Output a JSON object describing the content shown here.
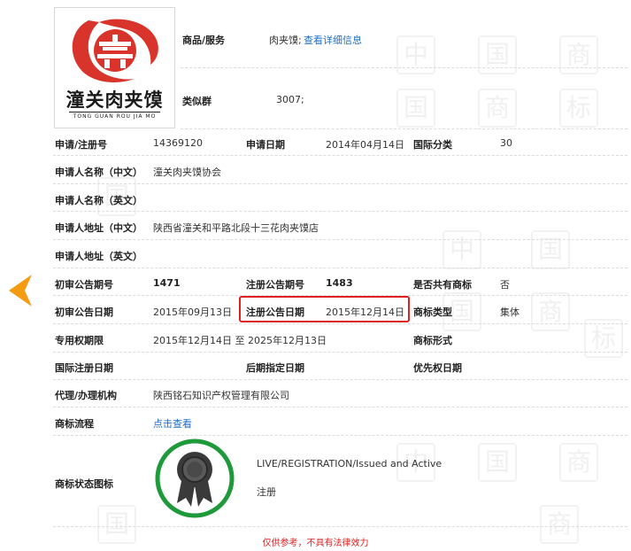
{
  "logo": {
    "name": "潼关肉夹馍",
    "subtitle": "TONG GUAN ROU JIA MO"
  },
  "colors": {
    "brand_red": "#d9342b",
    "link_blue": "#1e6fc8",
    "highlight_red": "#e02020",
    "badge_green": "#1e9a3a",
    "arrow_orange": "#f39c12"
  },
  "fields": {
    "goods_label": "商品/服务",
    "goods_value": "肉夹馍;",
    "goods_link": "查看详细信息",
    "group_label": "类似群",
    "group_value": "3007;",
    "reg_no_label": "申请/注册号",
    "reg_no_value": "14369120",
    "app_date_label": "申请日期",
    "app_date_value": "2014年04月14日",
    "intl_class_label": "国际分类",
    "intl_class_value": "30",
    "applicant_cn_label": "申请人名称（中文）",
    "applicant_cn_value": "潼关肉夹馍协会",
    "applicant_en_label": "申请人名称（英文）",
    "address_cn_label": "申请人地址（中文）",
    "address_cn_value": "陕西省潼关和平路北段十三花肉夹馍店",
    "address_en_label": "申请人地址（英文）",
    "prelim_no_label": "初审公告期号",
    "prelim_no_value": "1471",
    "reg_notice_no_label": "注册公告期号",
    "reg_notice_no_value": "1483",
    "shared_label": "是否共有商标",
    "shared_value": "否",
    "prelim_date_label": "初审公告日期",
    "prelim_date_value": "2015年09月13日",
    "reg_date_label": "注册公告日期",
    "reg_date_value": "2015年12月14日",
    "type_label": "商标类型",
    "type_value": "集体",
    "exclusive_label": "专用权期限",
    "exclusive_value": "2015年12月14日 至 2025年12月13日",
    "form_label": "商标形式",
    "intl_reg_date_label": "国际注册日期",
    "later_date_label": "后期指定日期",
    "priority_label": "优先权日期",
    "agent_label": "代理/办理机构",
    "agent_value": "陕西铭石知识产权管理有限公司",
    "flow_label": "商标流程",
    "flow_link": "点击查看",
    "status_icon_label": "商标状态图标",
    "status_en": "LIVE/REGISTRATION/Issued and Active",
    "status_cn": "注册"
  },
  "disclaimer": "仅供参考，不具有法律效力",
  "icons": {
    "nav": "chevron-left-icon",
    "status": "ribbon-award-icon"
  }
}
